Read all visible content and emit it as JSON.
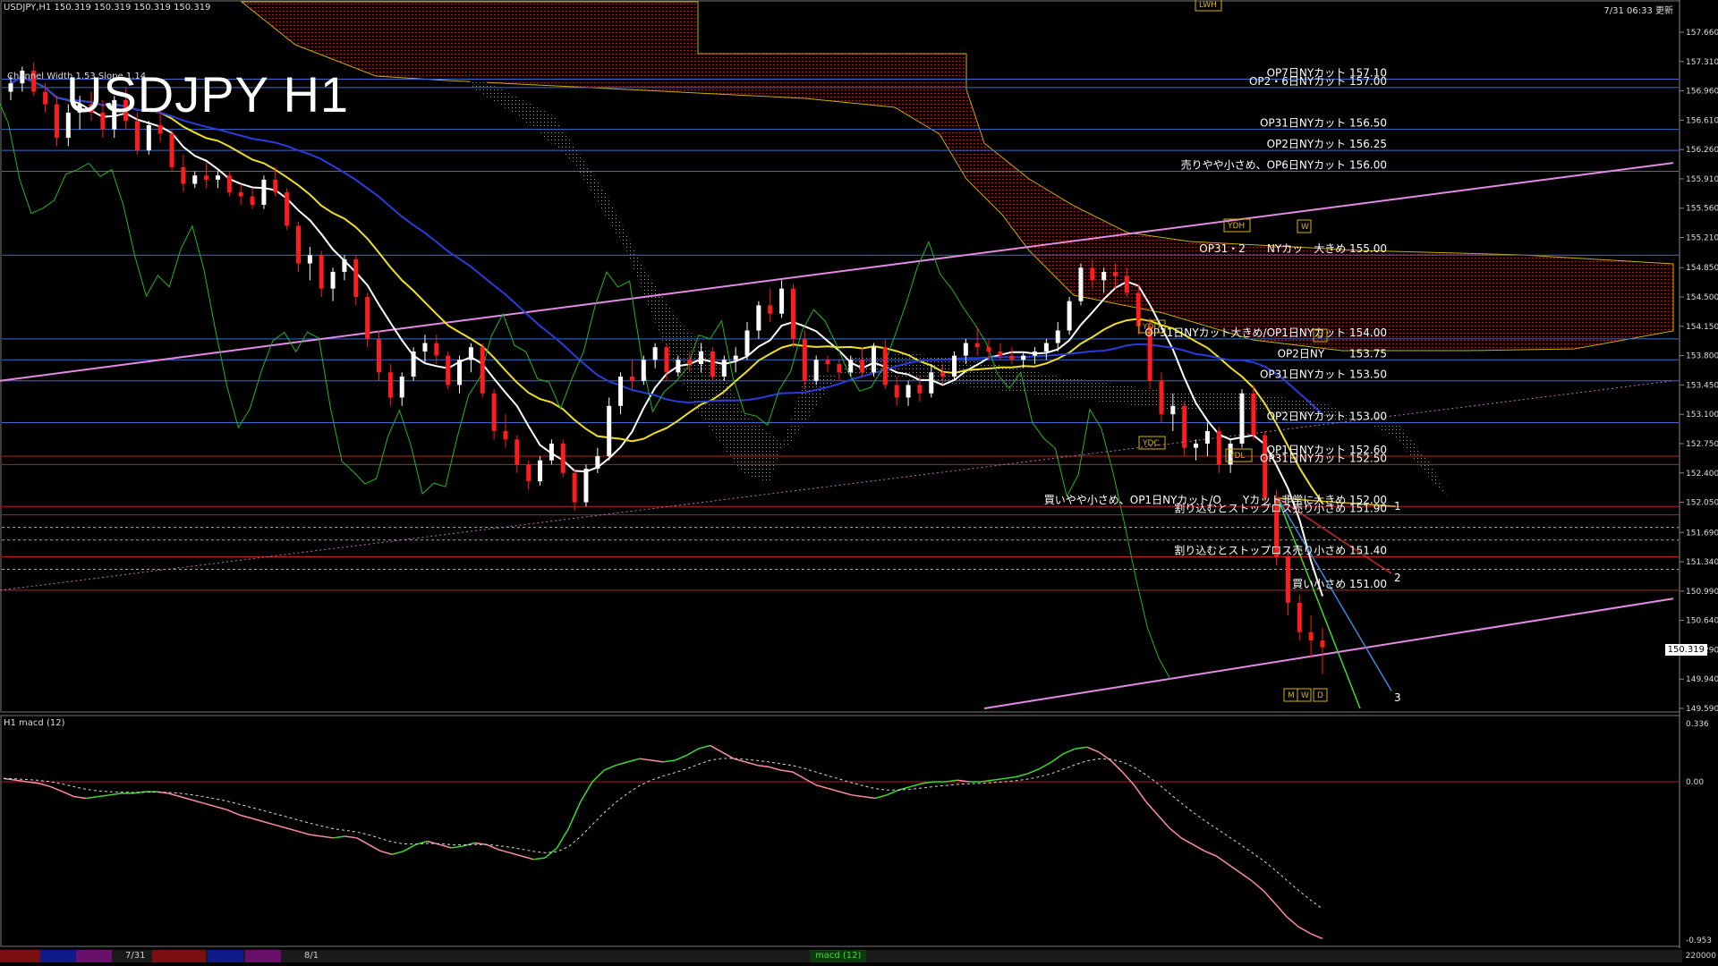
{
  "header": {
    "symbol_info": "USDJPY,H1  150.319 150.319 150.319 150.319",
    "channel_label": "Channel Width 1.53 Slope 1.14",
    "timestamp": "7/31 06:33 更新"
  },
  "title": "USDJPY H1",
  "sub_panel": {
    "label": "H1  macd (12)",
    "zero_label": "0.00",
    "top_label": "0.336",
    "bottom_label": "-0.953"
  },
  "current_price": "150.319",
  "bottom_bar": {
    "label_1": "7/31",
    "label_2": "8/1",
    "macd_tab": "macd (12)",
    "right_label": "220000"
  },
  "chart_data": {
    "type": "candlestick",
    "y_axis_ticks": [
      "157.660",
      "157.310",
      "156.960",
      "156.610",
      "156.260",
      "155.910",
      "155.560",
      "155.210",
      "154.850",
      "154.500",
      "154.150",
      "153.800",
      "153.450",
      "153.100",
      "152.750",
      "152.400",
      "152.050",
      "151.690",
      "151.340",
      "150.990",
      "150.640",
      "150.290",
      "149.940",
      "149.590"
    ],
    "ylim": [
      149.59,
      157.66
    ],
    "annotations": [
      {
        "text": "OP7日NYカット 157.10",
        "price": 157.1,
        "color": "#3c6cd0"
      },
      {
        "text": "OP2・6日NYカット 157.00",
        "price": 157.0,
        "color": "#3c6cd0"
      },
      {
        "text": "OP31日NYカット 156.50",
        "price": 156.5,
        "color": "#3c6cd0"
      },
      {
        "text": "OP2日NYカット 156.25",
        "price": 156.25,
        "color": "#3c6cd0"
      },
      {
        "text": "売りやや小さめ、OP6日NYカット 156.00",
        "price": 156.0,
        "color": "#3c6cd0"
      },
      {
        "text": "OP31・2　　NYカッ　大きめ 155.00",
        "price": 155.0,
        "color": "#3c6cd0"
      },
      {
        "text": "OP31日NYカット大きめ/OP1日NYカット 154.00",
        "price": 154.0,
        "color": "#3c6cd0"
      },
      {
        "text": "OP2日NY　　 153.75",
        "price": 153.75,
        "color": "#3c6cd0"
      },
      {
        "text": "OP31日NYカット 153.50",
        "price": 153.5,
        "color": "#3c6cd0"
      },
      {
        "text": "OP2日NYカット 153.00",
        "price": 153.0,
        "color": "#3c6cd0"
      },
      {
        "text": "OP1日NYカット 152.60",
        "price": 152.6,
        "color": "#c02020"
      },
      {
        "text": "OP31日NYカット 152.50",
        "price": 152.5,
        "color": "#c02020"
      },
      {
        "text": "買いやや小さめ、OP1日NYカット/O　　Yカット非常に大きめ 152.00",
        "price": 152.0,
        "color": "#c02020"
      },
      {
        "text": "割り込むとストップロス売り小さめ 151.90",
        "price": 151.9,
        "color": "#c02020"
      },
      {
        "text": "割り込むとストップロス売り小さめ 151.40",
        "price": 151.4,
        "color": "#c02020"
      },
      {
        "text": "買い小さめ 151.00",
        "price": 151.0,
        "color": "#c02020"
      }
    ],
    "box_labels": [
      "LWH",
      "YDH",
      "YDO",
      "YDC",
      "YDL",
      "W",
      "D",
      "M",
      "W",
      "D"
    ],
    "fan_labels": [
      "1",
      "2",
      "3"
    ],
    "candles": [
      [
        156.95,
        157.15,
        156.85,
        157.05
      ],
      [
        157.05,
        157.25,
        156.95,
        157.2
      ],
      [
        157.2,
        157.3,
        156.9,
        156.95
      ],
      [
        156.95,
        157.05,
        156.7,
        156.8
      ],
      [
        156.8,
        156.9,
        156.3,
        156.4
      ],
      [
        156.4,
        156.8,
        156.3,
        156.7
      ],
      [
        156.7,
        156.9,
        156.5,
        156.8
      ],
      [
        156.8,
        156.95,
        156.6,
        156.7
      ],
      [
        156.7,
        156.85,
        156.4,
        156.5
      ],
      [
        156.5,
        156.9,
        156.4,
        156.85
      ],
      [
        156.85,
        157.0,
        156.5,
        156.6
      ],
      [
        156.6,
        156.7,
        156.2,
        156.25
      ],
      [
        156.25,
        156.6,
        156.2,
        156.55
      ],
      [
        156.55,
        156.75,
        156.35,
        156.45
      ],
      [
        156.45,
        156.5,
        156.0,
        156.05
      ],
      [
        156.05,
        156.2,
        155.75,
        155.85
      ],
      [
        155.85,
        156.0,
        155.8,
        155.95
      ],
      [
        155.95,
        156.1,
        155.8,
        155.9
      ],
      [
        155.9,
        156.0,
        155.8,
        155.95
      ],
      [
        155.95,
        156.0,
        155.7,
        155.75
      ],
      [
        155.75,
        155.85,
        155.6,
        155.7
      ],
      [
        155.7,
        155.8,
        155.55,
        155.6
      ],
      [
        155.6,
        155.95,
        155.55,
        155.9
      ],
      [
        155.9,
        156.05,
        155.7,
        155.75
      ],
      [
        155.75,
        155.8,
        155.3,
        155.35
      ],
      [
        155.35,
        155.4,
        154.8,
        154.9
      ],
      [
        154.9,
        155.1,
        154.7,
        155.0
      ],
      [
        155.0,
        155.05,
        154.5,
        154.6
      ],
      [
        154.6,
        154.85,
        154.45,
        154.8
      ],
      [
        154.8,
        155.0,
        154.7,
        154.95
      ],
      [
        154.95,
        155.0,
        154.4,
        154.5
      ],
      [
        154.5,
        154.55,
        153.9,
        154.0
      ],
      [
        154.0,
        154.1,
        153.5,
        153.6
      ],
      [
        153.6,
        153.7,
        153.2,
        153.3
      ],
      [
        153.3,
        153.6,
        153.2,
        153.55
      ],
      [
        153.55,
        153.9,
        153.5,
        153.85
      ],
      [
        153.85,
        154.05,
        153.7,
        153.95
      ],
      [
        153.95,
        154.05,
        153.7,
        153.8
      ],
      [
        153.8,
        153.85,
        153.4,
        153.45
      ],
      [
        153.45,
        153.8,
        153.35,
        153.75
      ],
      [
        153.75,
        153.95,
        153.6,
        153.9
      ],
      [
        153.9,
        153.95,
        153.3,
        153.35
      ],
      [
        153.35,
        153.4,
        152.8,
        152.9
      ],
      [
        152.9,
        153.1,
        152.7,
        152.8
      ],
      [
        152.8,
        152.85,
        152.4,
        152.5
      ],
      [
        152.5,
        152.55,
        152.2,
        152.3
      ],
      [
        152.3,
        152.6,
        152.25,
        152.55
      ],
      [
        152.55,
        152.8,
        152.5,
        152.75
      ],
      [
        152.75,
        152.8,
        152.35,
        152.4
      ],
      [
        152.4,
        152.45,
        151.95,
        152.05
      ],
      [
        152.05,
        152.5,
        152.0,
        152.45
      ],
      [
        152.45,
        152.7,
        152.4,
        152.6
      ],
      [
        152.6,
        153.3,
        152.55,
        153.2
      ],
      [
        153.2,
        153.6,
        153.1,
        153.55
      ],
      [
        153.55,
        153.75,
        153.4,
        153.5
      ],
      [
        153.5,
        153.8,
        153.45,
        153.75
      ],
      [
        153.75,
        153.95,
        153.65,
        153.9
      ],
      [
        153.9,
        153.95,
        153.5,
        153.6
      ],
      [
        153.6,
        153.8,
        153.55,
        153.75
      ],
      [
        153.75,
        153.85,
        153.6,
        153.7
      ],
      [
        153.7,
        153.95,
        153.6,
        153.85
      ],
      [
        153.85,
        153.9,
        153.5,
        153.55
      ],
      [
        153.55,
        153.8,
        153.5,
        153.75
      ],
      [
        153.75,
        153.9,
        153.6,
        153.8
      ],
      [
        153.8,
        154.2,
        153.75,
        154.1
      ],
      [
        154.1,
        154.45,
        154.0,
        154.4
      ],
      [
        154.4,
        154.6,
        154.2,
        154.3
      ],
      [
        154.3,
        154.7,
        154.25,
        154.6
      ],
      [
        154.6,
        154.65,
        153.9,
        154.0
      ],
      [
        154.0,
        154.1,
        153.4,
        153.5
      ],
      [
        153.5,
        153.8,
        153.45,
        153.75
      ],
      [
        153.75,
        153.8,
        153.6,
        153.7
      ],
      [
        153.7,
        153.75,
        153.5,
        153.6
      ],
      [
        153.6,
        153.8,
        153.55,
        153.75
      ],
      [
        153.75,
        153.9,
        153.55,
        153.6
      ],
      [
        153.6,
        153.95,
        153.55,
        153.9
      ],
      [
        153.9,
        154.0,
        153.4,
        153.45
      ],
      [
        153.45,
        153.55,
        153.2,
        153.3
      ],
      [
        153.3,
        153.5,
        153.2,
        153.45
      ],
      [
        153.45,
        153.55,
        153.25,
        153.35
      ],
      [
        153.35,
        153.7,
        153.3,
        153.6
      ],
      [
        153.6,
        153.7,
        153.45,
        153.55
      ],
      [
        153.55,
        153.85,
        153.5,
        153.8
      ],
      [
        153.8,
        154.0,
        153.7,
        153.95
      ],
      [
        153.95,
        154.15,
        153.8,
        153.9
      ],
      [
        153.9,
        154.0,
        153.75,
        153.85
      ],
      [
        153.85,
        153.95,
        153.75,
        153.8
      ],
      [
        153.8,
        153.9,
        153.7,
        153.75
      ],
      [
        153.75,
        153.85,
        153.65,
        153.8
      ],
      [
        153.8,
        153.9,
        153.7,
        153.85
      ],
      [
        153.85,
        154.0,
        153.75,
        153.95
      ],
      [
        153.95,
        154.2,
        153.85,
        154.1
      ],
      [
        154.1,
        154.5,
        154.05,
        154.45
      ],
      [
        154.45,
        154.9,
        154.4,
        154.85
      ],
      [
        154.85,
        154.95,
        154.6,
        154.7
      ],
      [
        154.7,
        154.85,
        154.55,
        154.8
      ],
      [
        154.8,
        154.9,
        154.6,
        154.75
      ],
      [
        154.75,
        154.85,
        154.5,
        154.55
      ],
      [
        154.55,
        154.65,
        154.05,
        154.15
      ],
      [
        154.15,
        154.25,
        153.4,
        153.5
      ],
      [
        153.5,
        153.6,
        153.0,
        153.1
      ],
      [
        153.1,
        153.35,
        152.9,
        153.2
      ],
      [
        153.2,
        153.25,
        152.6,
        152.7
      ],
      [
        152.7,
        152.8,
        152.55,
        152.75
      ],
      [
        152.75,
        153.0,
        152.6,
        152.9
      ],
      [
        152.9,
        152.95,
        152.4,
        152.5
      ],
      [
        152.5,
        152.8,
        152.4,
        152.75
      ],
      [
        152.75,
        153.4,
        152.7,
        153.35
      ],
      [
        153.35,
        153.45,
        152.8,
        152.85
      ],
      [
        152.85,
        152.9,
        152.0,
        152.1
      ],
      [
        152.1,
        152.2,
        151.3,
        151.4
      ],
      [
        151.4,
        151.5,
        150.7,
        150.85
      ],
      [
        150.85,
        150.95,
        150.4,
        150.5
      ],
      [
        150.5,
        150.7,
        150.2,
        150.4
      ],
      [
        150.4,
        150.55,
        150.0,
        150.319
      ]
    ],
    "macd_values": [
      0.02,
      0.01,
      0.0,
      -0.01,
      -0.03,
      -0.06,
      -0.09,
      -0.1,
      -0.09,
      -0.08,
      -0.07,
      -0.07,
      -0.06,
      -0.06,
      -0.07,
      -0.09,
      -0.11,
      -0.13,
      -0.15,
      -0.17,
      -0.2,
      -0.22,
      -0.24,
      -0.26,
      -0.28,
      -0.3,
      -0.32,
      -0.33,
      -0.34,
      -0.33,
      -0.34,
      -0.38,
      -0.42,
      -0.44,
      -0.42,
      -0.38,
      -0.36,
      -0.38,
      -0.4,
      -0.39,
      -0.37,
      -0.38,
      -0.41,
      -0.43,
      -0.45,
      -0.47,
      -0.46,
      -0.4,
      -0.28,
      -0.12,
      0.0,
      0.07,
      0.1,
      0.12,
      0.14,
      0.13,
      0.12,
      0.13,
      0.16,
      0.2,
      0.22,
      0.18,
      0.14,
      0.12,
      0.1,
      0.09,
      0.07,
      0.06,
      0.02,
      -0.02,
      -0.04,
      -0.06,
      -0.08,
      -0.09,
      -0.1,
      -0.08,
      -0.05,
      -0.03,
      -0.01,
      0.0,
      0.0,
      0.01,
      0.0,
      0.0,
      0.01,
      0.02,
      0.03,
      0.05,
      0.08,
      0.12,
      0.17,
      0.2,
      0.21,
      0.18,
      0.13,
      0.06,
      -0.02,
      -0.12,
      -0.2,
      -0.28,
      -0.34,
      -0.38,
      -0.42,
      -0.45,
      -0.5,
      -0.55,
      -0.6,
      -0.66,
      -0.74,
      -0.82,
      -0.88,
      -0.92,
      -0.95
    ],
    "macd_ylim": [
      -0.953,
      0.336
    ],
    "macd_colors": {
      "up": "#3fdc2f",
      "down": "#ff8ca0",
      "signal": "#d8d8d8",
      "zero": "#c01818"
    }
  }
}
